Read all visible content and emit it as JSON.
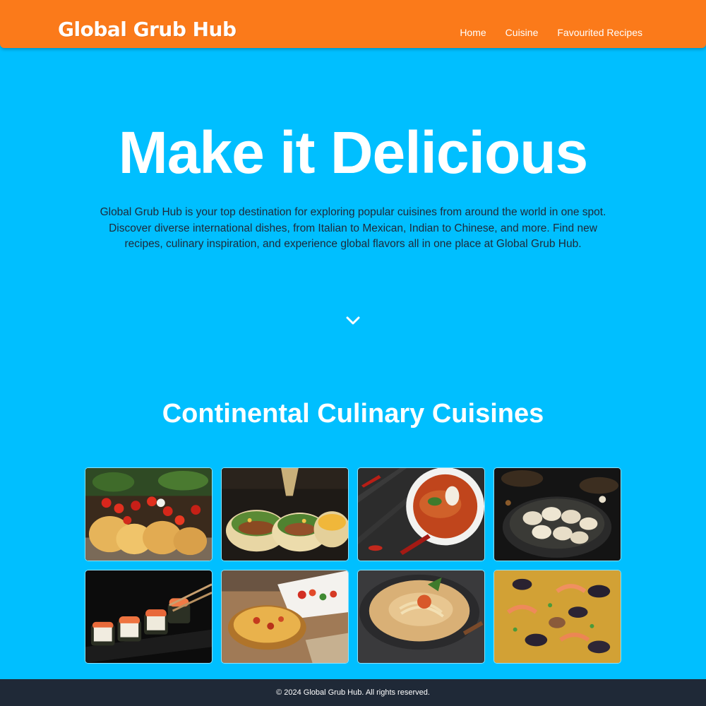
{
  "header": {
    "logo": "Global Grub Hub",
    "nav": [
      {
        "label": "Home"
      },
      {
        "label": "Cuisine"
      },
      {
        "label": "Favourited Recipes"
      }
    ],
    "background_color": "#fb7a1a"
  },
  "hero": {
    "title": "Make it Delicious",
    "description": "Global Grub Hub is your top destination for exploring popular cuisines from around the world in one spot. Discover diverse international dishes, from Italian to Mexican, Indian to Chinese, and more. Find new recipes, culinary inspiration, and experience global flavors all in one place at Global Grub Hub.",
    "scroll_icon": "chevron-down-icon"
  },
  "cuisines": {
    "title": "Continental Culinary Cuisines",
    "items": [
      {
        "image": "pasta-tomatoes-photo"
      },
      {
        "image": "tacos-photo"
      },
      {
        "image": "curry-soup-photo"
      },
      {
        "image": "dumplings-photo"
      },
      {
        "image": "sushi-rolls-photo"
      },
      {
        "image": "quiche-photo"
      },
      {
        "image": "ramen-bowl-photo"
      },
      {
        "image": "paella-photo"
      }
    ]
  },
  "footer": {
    "text": "© 2024 Global Grub Hub. All rights reserved."
  },
  "colors": {
    "page_background": "#00bfff",
    "header_background": "#fb7a1a",
    "footer_background": "#1f2937",
    "text_white": "#ffffff",
    "text_dark": "#1e2a3a"
  }
}
